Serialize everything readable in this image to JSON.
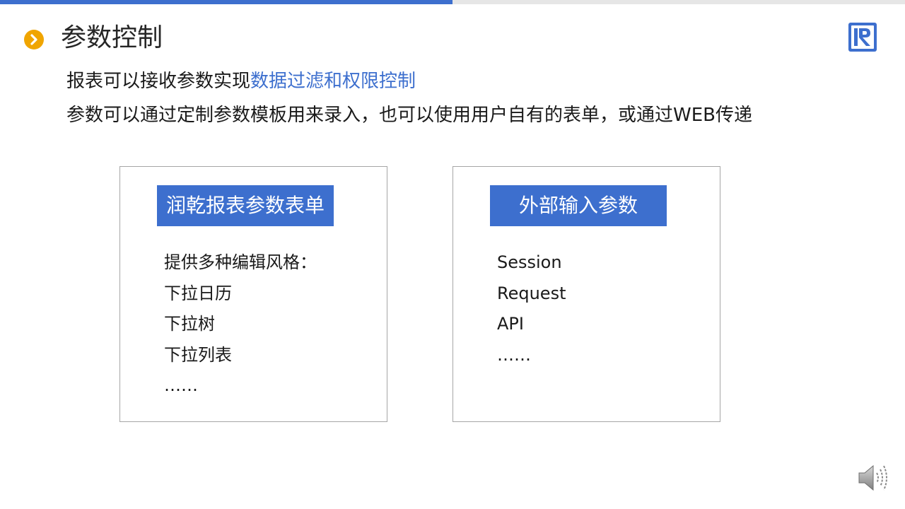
{
  "slide": {
    "progress": 0.5,
    "title": "参数控制",
    "accent_color": "#3d6fce",
    "bullet_color": "#f0a500",
    "bullet_icon": "chevron-right-icon",
    "logo_icon": "runqian-r-logo-icon"
  },
  "intro": {
    "line1_prefix": "报表可以接收参数实现",
    "line1_highlight": "数据过滤和权限控制",
    "line2": "参数可以通过定制参数模板用来录入，也可以使用用户自有的表单，或通过WEB传递"
  },
  "panels": [
    {
      "header": "润乾报表参数表单",
      "items": [
        "提供多种编辑风格：",
        "下拉日历",
        "下拉树",
        "下拉列表",
        "……"
      ]
    },
    {
      "header": "外部输入参数",
      "items": [
        "Session",
        "Request",
        "API",
        "……"
      ]
    }
  ],
  "media": {
    "icon": "speaker-icon"
  }
}
